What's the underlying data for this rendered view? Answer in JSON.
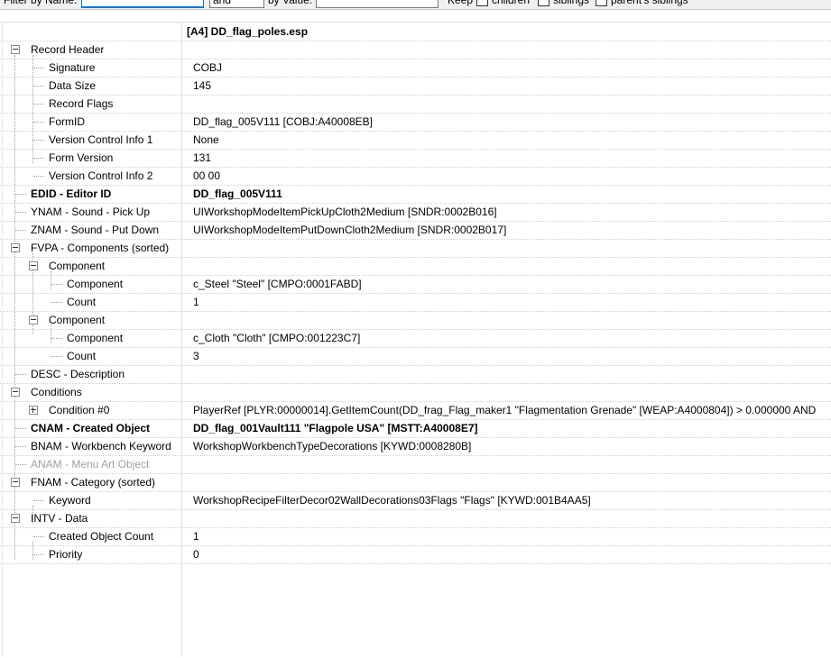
{
  "filter_bar": {
    "name_label": "Filter by Name:",
    "name_value": "",
    "operator": "and",
    "value_label": "by Value:",
    "value_value": "",
    "keep_label": "Keep",
    "children_label": "children",
    "siblings_label": "siblings",
    "parents_siblings_label": "parent's siblings"
  },
  "header": {
    "plugin": "[A4] DD_flag_poles.esp"
  },
  "rows": [
    {
      "name": "Record Header",
      "value": ""
    },
    {
      "name": "Signature",
      "value": "COBJ"
    },
    {
      "name": "Data Size",
      "value": "145"
    },
    {
      "name": "Record Flags",
      "value": ""
    },
    {
      "name": "FormID",
      "value": "DD_flag_005V111 [COBJ:A40008EB]"
    },
    {
      "name": "Version Control Info 1",
      "value": "None"
    },
    {
      "name": "Form Version",
      "value": "131"
    },
    {
      "name": "Version Control Info 2",
      "value": "00 00"
    },
    {
      "name": "EDID - Editor ID",
      "value": "DD_flag_005V111"
    },
    {
      "name": "YNAM - Sound - Pick Up",
      "value": "UIWorkshopModeItemPickUpCloth2Medium [SNDR:0002B016]"
    },
    {
      "name": "ZNAM - Sound - Put Down",
      "value": "UIWorkshopModeItemPutDownCloth2Medium [SNDR:0002B017]"
    },
    {
      "name": "FVPA - Components (sorted)",
      "value": ""
    },
    {
      "name": "Component",
      "value": ""
    },
    {
      "name": "Component",
      "value": "c_Steel \"Steel\" [CMPO:0001FABD]"
    },
    {
      "name": "Count",
      "value": "1"
    },
    {
      "name": "Component",
      "value": ""
    },
    {
      "name": "Component",
      "value": "c_Cloth \"Cloth\" [CMPO:001223C7]"
    },
    {
      "name": "Count",
      "value": "3"
    },
    {
      "name": "DESC - Description",
      "value": ""
    },
    {
      "name": "Conditions",
      "value": ""
    },
    {
      "name": "Condition #0",
      "value": "PlayerRef [PLYR:00000014].GetItemCount(DD_frag_Flag_maker1 \"Flagmentation Grenade\" [WEAP:A4000804]) > 0.000000 AND"
    },
    {
      "name": "CNAM - Created Object",
      "value": "DD_flag_001Vault111 \"Flagpole USA\" [MSTT:A40008E7]"
    },
    {
      "name": "BNAM - Workbench Keyword",
      "value": "WorkshopWorkbenchTypeDecorations [KYWD:0008280B]"
    },
    {
      "name": "ANAM - Menu Art Object",
      "value": ""
    },
    {
      "name": "FNAM - Category (sorted)",
      "value": ""
    },
    {
      "name": "Keyword",
      "value": "WorkshopRecipeFilterDecor02WallDecorations03Flags \"Flags\" [KYWD:001B4AA5]"
    },
    {
      "name": "INTV - Data",
      "value": ""
    },
    {
      "name": "Created Object Count",
      "value": "1"
    },
    {
      "name": "Priority",
      "value": "0"
    }
  ],
  "colors": {
    "grid_line": "#d0d0d0",
    "disabled_text": "#a0a0a0",
    "focus": "#0078d7"
  },
  "icons": {
    "expand_collapsed": "plus-box-icon",
    "expand_open": "minus-box-icon"
  }
}
